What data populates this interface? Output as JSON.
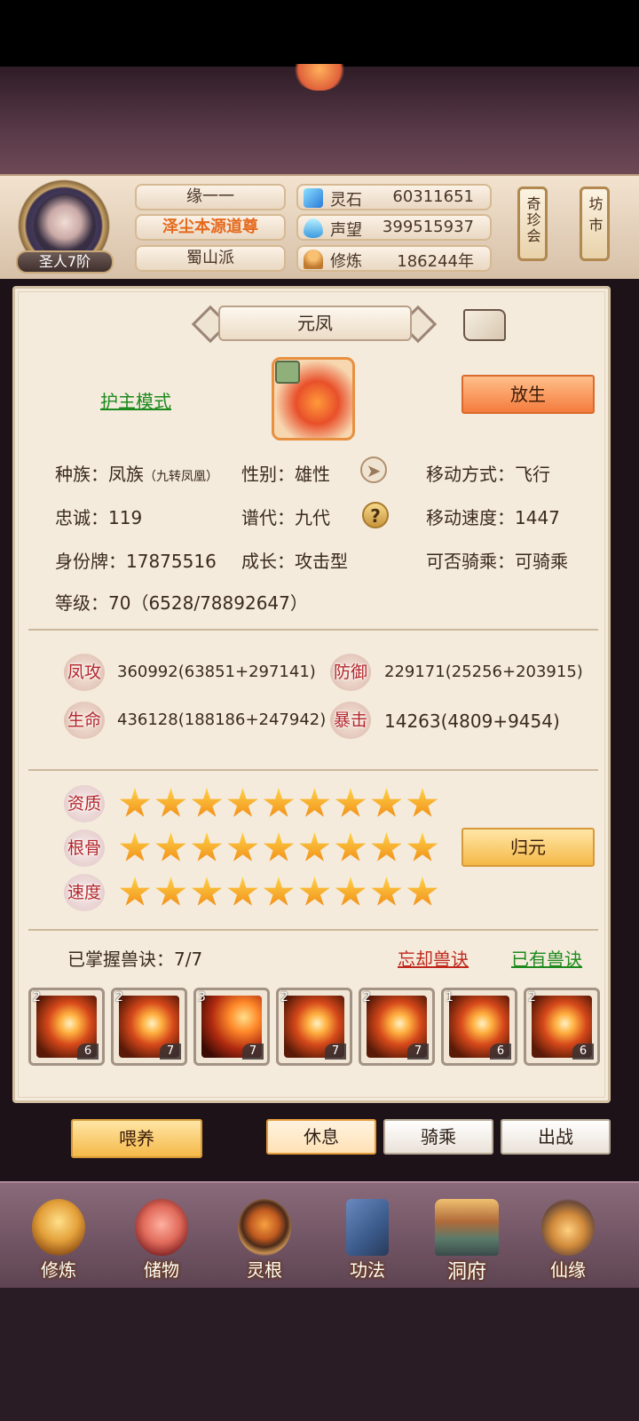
{
  "header": {
    "rank": "圣人7阶",
    "name": "缘一一",
    "title": "泽尘本源道尊",
    "sect": "蜀山派",
    "resources": [
      {
        "icon": "spirit-stone-icon",
        "label": "灵石",
        "value": "60311651"
      },
      {
        "icon": "prestige-icon",
        "label": "声望",
        "value": "399515937"
      },
      {
        "icon": "cultivation-icon",
        "label": "修炼",
        "value": "186244年"
      }
    ],
    "side_buttons": [
      "奇珍会",
      "坊市"
    ]
  },
  "pet": {
    "name": "元凤",
    "guard_mode": "护主模式",
    "release": "放生",
    "info": {
      "race_label": "种族：",
      "race_value": "凤族",
      "race_sub": "（九转凤凰）",
      "gender": "性别：雄性",
      "move_type": "移动方式：飞行",
      "loyalty": "忠诚：119",
      "generation": "谱代：九代",
      "move_speed": "移动速度：1447",
      "id_tag": "身份牌：17875516",
      "growth": "成长：攻击型",
      "rideable": "可否骑乘：可骑乘",
      "level": "等级：70（6528/78892647）"
    },
    "stats": [
      {
        "label": "凤攻",
        "value": "360992(63851+297141)"
      },
      {
        "label": "防御",
        "value": "229171(25256+203915)"
      },
      {
        "label": "生命",
        "value": "436128(188186+247942)"
      },
      {
        "label": "暴击",
        "value": "14263(4809+9454)"
      }
    ],
    "qualities": [
      {
        "label": "资质",
        "stars": 9
      },
      {
        "label": "根骨",
        "stars": 9
      },
      {
        "label": "速度",
        "stars": 9
      }
    ],
    "return_button": "归元",
    "skills_mastered": "已掌握兽诀：7/7",
    "forget_skill": "忘却兽诀",
    "owned_skills": "已有兽诀",
    "skills": [
      {
        "tier": "2",
        "level": "6"
      },
      {
        "tier": "2",
        "level": "7"
      },
      {
        "tier": "3",
        "level": "7"
      },
      {
        "tier": "2",
        "level": "7"
      },
      {
        "tier": "2",
        "level": "7"
      },
      {
        "tier": "1",
        "level": "6"
      },
      {
        "tier": "2",
        "level": "6"
      }
    ],
    "actions": {
      "feed": "喂养",
      "rest": "休息",
      "ride": "骑乘",
      "battle": "出战"
    }
  },
  "nav": [
    "修炼",
    "储物",
    "灵根",
    "功法",
    "洞府",
    "仙缘"
  ]
}
